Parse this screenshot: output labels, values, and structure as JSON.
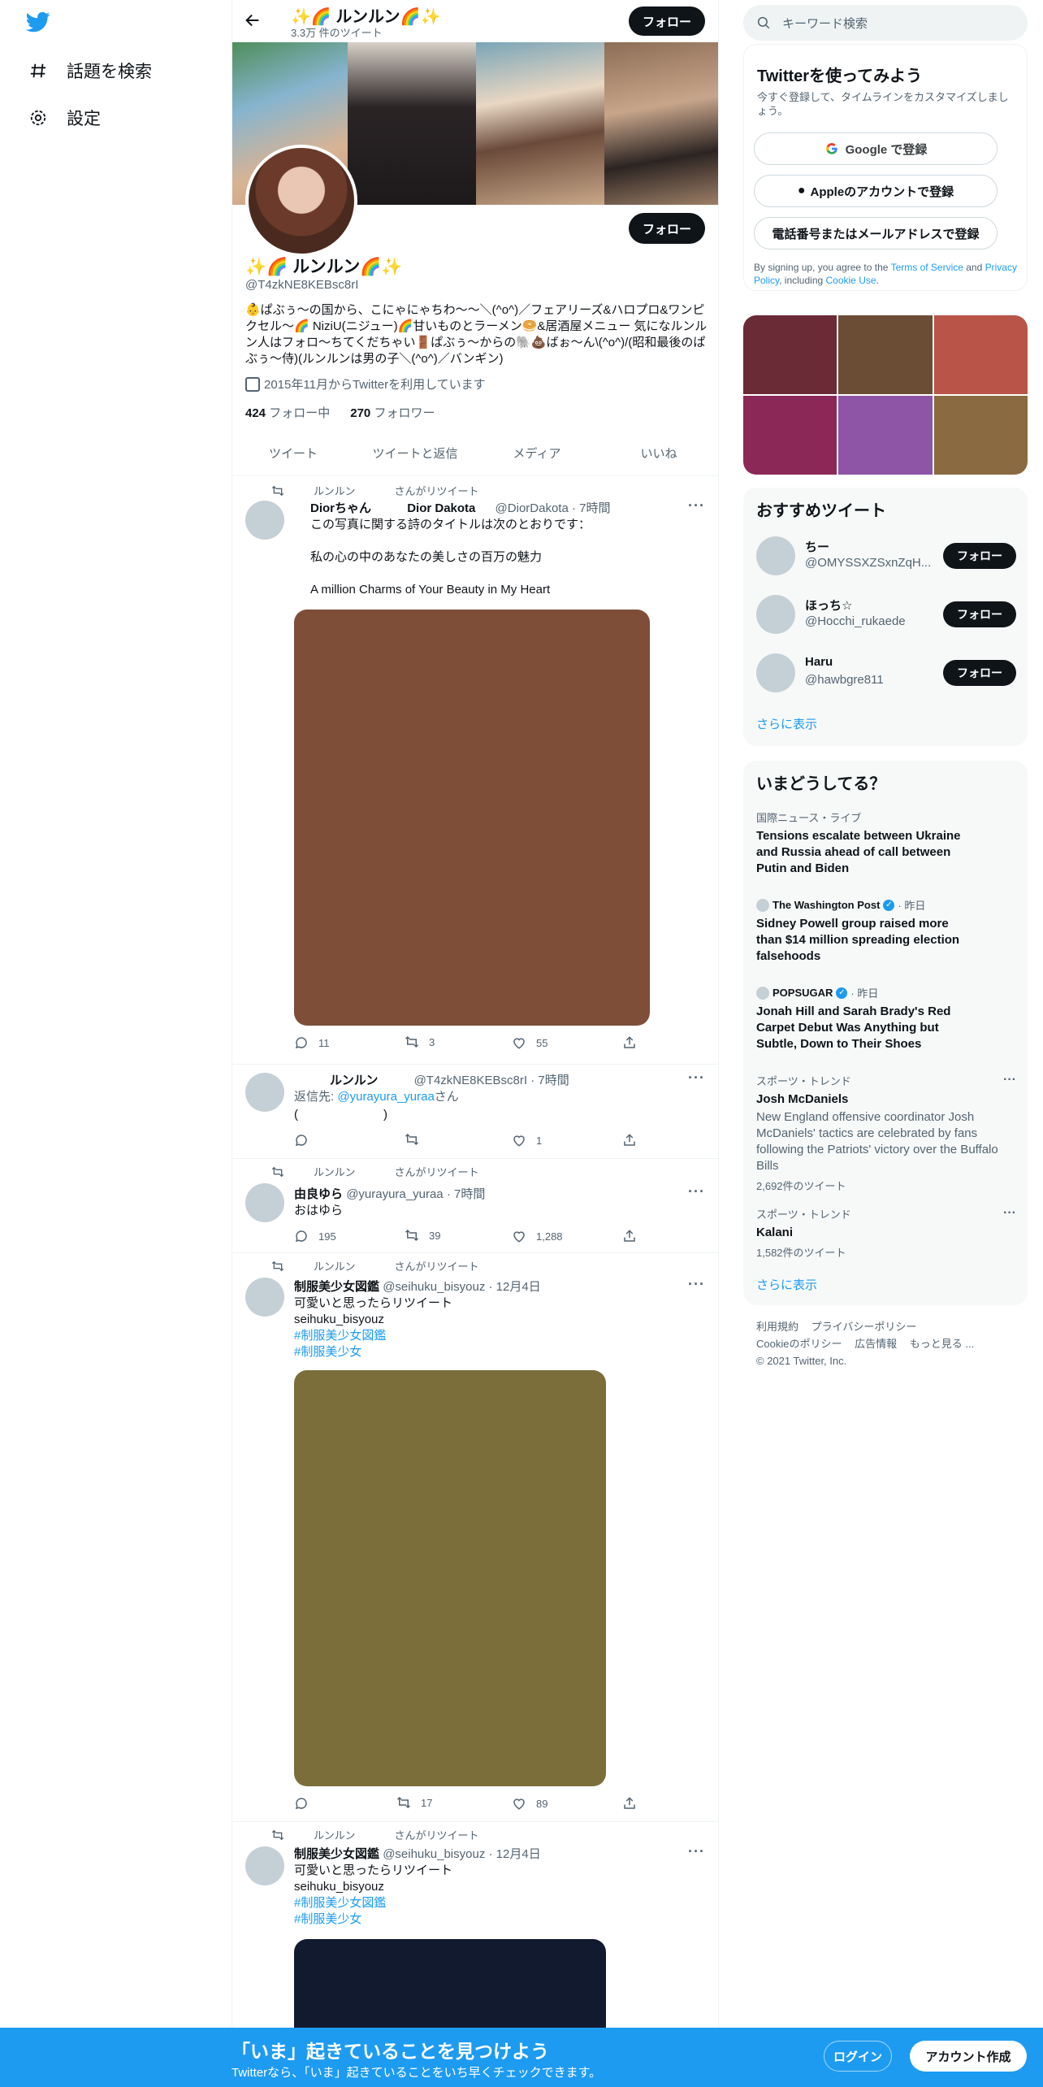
{
  "nav": {
    "explore_label": "話題を検索",
    "settings_label": "設定"
  },
  "header": {
    "title": "✨🌈 ルンルン🌈✨",
    "tweet_count": "3.3万 件のツイート",
    "follow_label": "フォロー"
  },
  "profile": {
    "name": "✨🌈 ルンルン🌈✨",
    "handle": "@T4zkNE8KEBsc8rI",
    "bio": "👶ぱぶぅ〜の国から、こにゃにゃちわ〜〜＼(^o^)／フェアリーズ&ハロプロ&ワンピクセル〜🌈 NiziU(ニジュー)🌈甘いものとラーメン🥯&居酒屋メニュー 気になルンルン人はフォロ〜ちてくだちゃい🚪ぱぶぅ〜からの🐘💩ばぉ〜ん\\(^o^)/(昭和最後のぱぶぅ〜侍)(ルンルンは男の子＼(^o^)／バンギン)",
    "joined": "2015年11月からTwitterを利用しています",
    "following_count": "424",
    "following_label": "フォロー中",
    "followers_count": "270",
    "followers_label": "フォロワー",
    "follow_label": "フォロー"
  },
  "tabs": [
    "ツイート",
    "ツイートと返信",
    "メディア",
    "いいね"
  ],
  "tweets": [
    {
      "retweet_by": "ルンルン",
      "retweet_suffix": "さんがリツイート",
      "name": "Diorちゃん",
      "name2": "Dior Dakota",
      "handle": "@DiorDakota",
      "time": "· 7時間",
      "line1": "この写真に関する詩のタイトルは次のとおりです：",
      "line2": "私の心の中のあなたの美しさの百万の魅力",
      "line3": "A million Charms of Your Beauty in My Heart",
      "media_color": "#7e4e39",
      "replies": "11",
      "retweets": "3",
      "likes": "55"
    },
    {
      "name": "ルンルン",
      "handle": "@T4zkNE8KEBsc8rI",
      "time": "· 7時間",
      "reply_prefix": "返信先: ",
      "reply_to": "@yurayura_yuraa",
      "reply_suffix": "さん",
      "text": "(　　　　　　　)",
      "replies": "",
      "retweets": "",
      "likes": "1"
    },
    {
      "retweet_by": "ルンルン",
      "retweet_suffix": "さんがリツイート",
      "name": "由良ゆら",
      "handle": "@yurayura_yuraa",
      "time": "· 7時間",
      "text": "おはゆら",
      "replies": "195",
      "retweets": "39",
      "likes": "1,288"
    },
    {
      "retweet_by": "ルンルン",
      "retweet_suffix": "さんがリツイート",
      "name": "制服美少女図鑑",
      "handle": "@seihuku_bisyouz",
      "time": "· 12月4日",
      "line1": "可愛いと思ったらリツイート",
      "line2": "seihuku_bisyouz",
      "tag1": "#制服美少女図鑑",
      "tag2": "#制服美少女",
      "media_color": "#7b6e3a",
      "replies": "",
      "retweets": "17",
      "likes": "89"
    },
    {
      "retweet_by": "ルンルン",
      "retweet_suffix": "さんがリツイート",
      "name": "制服美少女図鑑",
      "handle": "@seihuku_bisyouz",
      "time": "· 12月4日",
      "line1": "可愛いと思ったらリツイート",
      "line2": "seihuku_bisyouz",
      "tag1": "#制服美少女図鑑",
      "tag2": "#制服美少女",
      "media_color": "#121a30"
    }
  ],
  "right": {
    "search_placeholder": "キーワード検索",
    "signup_title": "Twitterを使ってみよう",
    "signup_sub": "今すぐ登録して、タイムラインをカスタマイズしましょう。",
    "google_btn": "Google で登録",
    "apple_btn": "Appleのアカウントで登録",
    "phone_btn": "電話番号またはメールアドレスで登録",
    "terms_prefix": "By signing up, you agree to the ",
    "terms_link": "Terms of Service",
    "terms_and": " and ",
    "privacy_link": "Privacy Policy",
    "terms_including": ", including ",
    "cookie_link": "Cookie Use",
    "terms_end": ".",
    "grid_colors": [
      "#6a2a36",
      "#6b4c35",
      "#b85448",
      "#8b2858",
      "#8e54a6",
      "#8a6a40"
    ],
    "rec_title": "おすすめツイート",
    "recommendations": [
      {
        "name": "ちー",
        "handle": "@OMYSSXZSxnZqH...",
        "btn": "フォロー"
      },
      {
        "name": "ほっち☆",
        "handle": "@Hocchi_rukaede",
        "btn": "フォロー"
      },
      {
        "name": "Haru",
        "handle": "@hawbgre811",
        "btn": "フォロー"
      }
    ],
    "rec_more": "さらに表示",
    "trends_title": "いまどうしてる？",
    "trends": [
      {
        "meta": "国際ニュース・ライブ",
        "title": "Tensions escalate between Ukraine and Russia ahead of call between Putin and Biden"
      },
      {
        "source": "The Washington Post",
        "time": "· 昨日",
        "title": "Sidney Powell group raised more than $14 million spreading election falsehoods"
      },
      {
        "source": "POPSUGAR",
        "time": "· 昨日",
        "title": "Jonah Hill and Sarah Brady's Red Carpet Debut Was Anything but Subtle, Down to Their Shoes"
      },
      {
        "meta": "スポーツ・トレンド",
        "title": "Josh McDaniels",
        "desc": "New England offensive coordinator Josh McDaniels' tactics are celebrated by fans following the Patriots' victory over the Buffalo Bills",
        "count": "2,692件のツイート"
      },
      {
        "meta": "スポーツ・トレンド",
        "title": "Kalani",
        "count": "1,582件のツイート"
      }
    ],
    "trends_more": "さらに表示",
    "footer_links": [
      "利用規約",
      "プライバシーポリシー",
      "Cookieのポリシー",
      "広告情報",
      "もっと見る ..."
    ],
    "copyright": "© 2021 Twitter, Inc."
  },
  "bottom": {
    "title": "「いま」起きていることを見つけよう",
    "sub": "Twitterなら、「いま」起きていることをいち早くチェックできます。",
    "login": "ログイン",
    "signup": "アカウント作成"
  },
  "colors": {
    "accent": "#1d9bf0",
    "dark": "#0f1419",
    "secondary_text": "#536471"
  }
}
